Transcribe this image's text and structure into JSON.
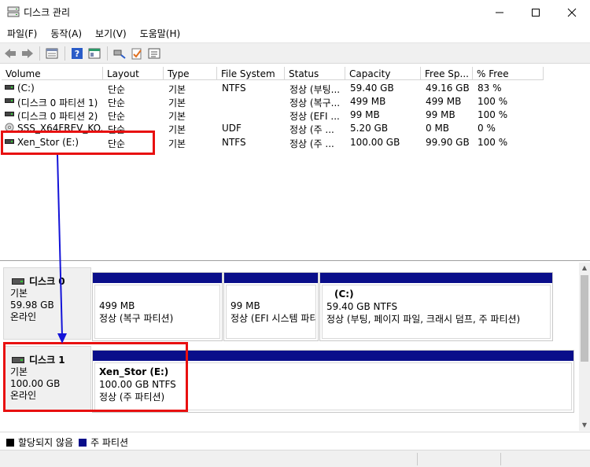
{
  "window": {
    "title": "디스크 관리"
  },
  "menu": [
    "파일(F)",
    "동작(A)",
    "보기(V)",
    "도움말(H)"
  ],
  "columns": [
    "Volume",
    "Layout",
    "Type",
    "File System",
    "Status",
    "Capacity",
    "Free Sp...",
    "% Free"
  ],
  "volumes": [
    {
      "volume": "(C:)",
      "layout": "단순",
      "type": "기본",
      "fs": "NTFS",
      "status": "정상 (부팅...",
      "capacity": "59.40 GB",
      "free": "49.16 GB",
      "pct": "83 %",
      "icon": "volume-icon"
    },
    {
      "volume": "(디스크 0 파티션 1)",
      "layout": "단순",
      "type": "기본",
      "fs": "",
      "status": "정상 (복구...",
      "capacity": "499 MB",
      "free": "499 MB",
      "pct": "100 %",
      "icon": "volume-icon"
    },
    {
      "volume": "(디스크 0 파티션 2)",
      "layout": "단순",
      "type": "기본",
      "fs": "",
      "status": "정상 (EFI ...",
      "capacity": "99 MB",
      "free": "99 MB",
      "pct": "100 %",
      "icon": "volume-icon"
    },
    {
      "volume": "SSS_X64FREV_KO...",
      "layout": "단순",
      "type": "기본",
      "fs": "UDF",
      "status": "정상 (주 ...",
      "capacity": "5.20 GB",
      "free": "0 MB",
      "pct": "0 %",
      "icon": "cd-icon"
    },
    {
      "volume": "Xen_Stor (E:)",
      "layout": "단순",
      "type": "기본",
      "fs": "NTFS",
      "status": "정상 (주 ...",
      "capacity": "100.00 GB",
      "free": "99.90 GB",
      "pct": "100 %",
      "icon": "volume-icon"
    }
  ],
  "disks": [
    {
      "name": "디스크 0",
      "type": "기본",
      "size": "59.98 GB",
      "state": "온라인",
      "partitions": [
        {
          "title": "",
          "line1": "499 MB",
          "line2": "정상 (복구 파티션)"
        },
        {
          "title": "",
          "line1": "99 MB",
          "line2": "정상 (EFI 시스템 파티션)"
        },
        {
          "title": "(C:)",
          "line1": "59.40 GB NTFS",
          "line2": "정상 (부팅, 페이지 파일, 크래시 덤프, 주 파티션)"
        }
      ]
    },
    {
      "name": "디스크 1",
      "type": "기본",
      "size": "100.00 GB",
      "state": "온라인",
      "partitions": [
        {
          "title": "Xen_Stor  (E:)",
          "line1": "100.00 GB NTFS",
          "line2": "정상 (주 파티션)"
        }
      ]
    }
  ],
  "legend": [
    {
      "label": "할당되지 않음",
      "color": "#000000"
    },
    {
      "label": "주 파티션",
      "color": "#0a0e8a"
    }
  ],
  "colors": {
    "partition_bar": "#0a0e8a",
    "annotation_box": "#e81010",
    "annotation_arrow": "#1414d8"
  }
}
